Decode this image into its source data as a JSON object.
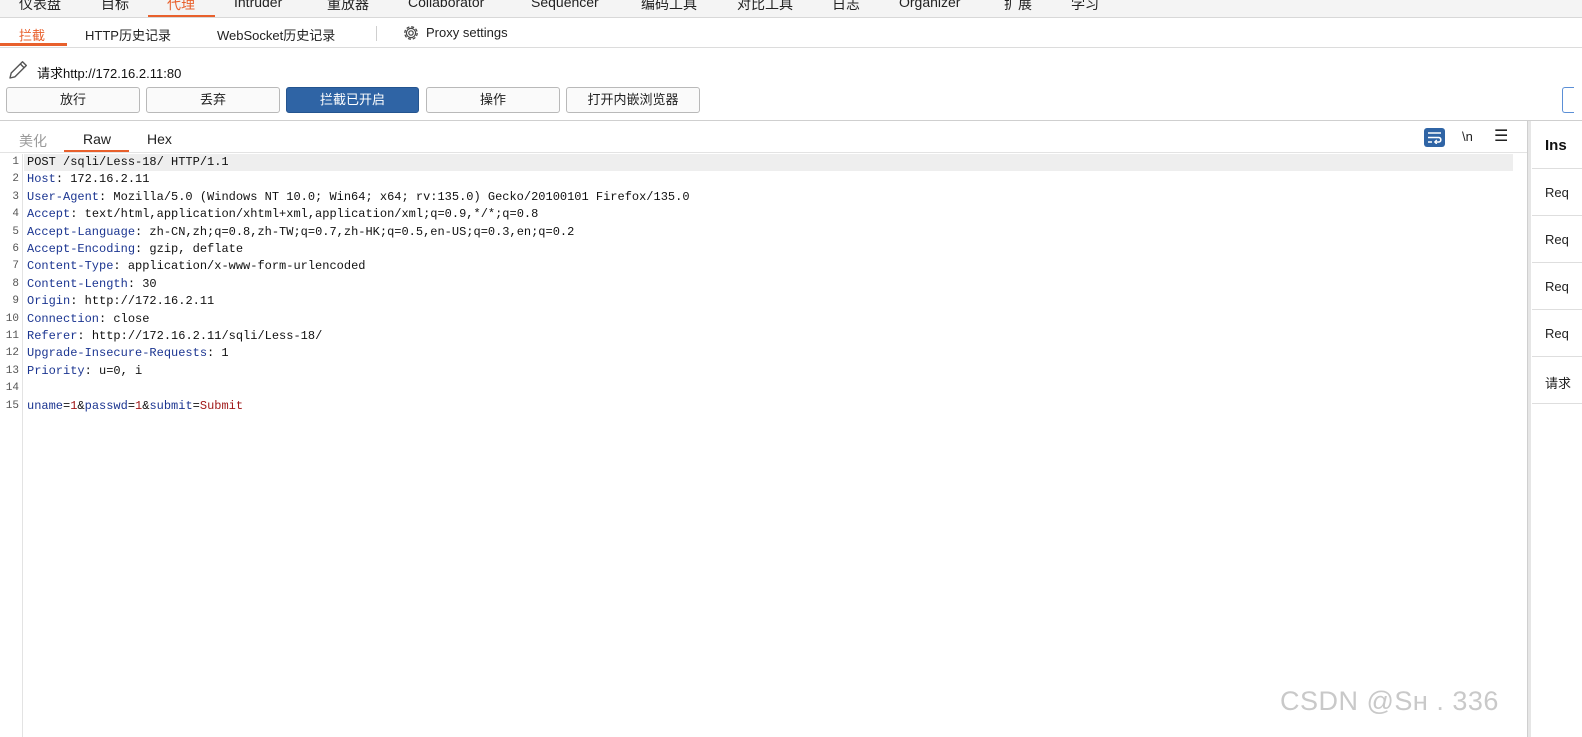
{
  "topnav": {
    "tabs": [
      "仪表盘",
      "目标",
      "代理",
      "Intruder",
      "重放器",
      "Collaborator",
      "Sequencer",
      "编码工具",
      "对比工具",
      "日志",
      "Organizer",
      "扩展",
      "学习"
    ],
    "active_tab": "代理"
  },
  "subnav": {
    "tabs": [
      "拦截",
      "HTTP历史记录",
      "WebSocket历史记录"
    ],
    "active_tab": "拦截",
    "proxy_settings": "Proxy settings"
  },
  "request": {
    "label": "请求http://172.16.2.11:80"
  },
  "buttons": {
    "forward": "放行",
    "drop": "丢弃",
    "intercept": "拦截已开启",
    "action": "操作",
    "open_browser": "打开内嵌浏览器"
  },
  "editor": {
    "tabs": [
      "美化",
      "Raw",
      "Hex"
    ],
    "active_tab": "Raw",
    "newline_toggle": "\\n",
    "menu_icon": "☰",
    "lines": [
      {
        "n": "1",
        "text": "POST /sqli/Less-18/ HTTP/1.1"
      },
      {
        "n": "2",
        "name": "Host",
        "value": " 172.16.2.11"
      },
      {
        "n": "3",
        "name": "User-Agent",
        "value": " Mozilla/5.0 (Windows NT 10.0; Win64; x64; rv:135.0) Gecko/20100101 Firefox/135.0"
      },
      {
        "n": "4",
        "name": "Accept",
        "value": " text/html,application/xhtml+xml,application/xml;q=0.9,*/*;q=0.8"
      },
      {
        "n": "5",
        "name": "Accept-Language",
        "value": " zh-CN,zh;q=0.8,zh-TW;q=0.7,zh-HK;q=0.5,en-US;q=0.3,en;q=0.2"
      },
      {
        "n": "6",
        "name": "Accept-Encoding",
        "value": " gzip, deflate"
      },
      {
        "n": "7",
        "name": "Content-Type",
        "value": " application/x-www-form-urlencoded"
      },
      {
        "n": "8",
        "name": "Content-Length",
        "value": " 30"
      },
      {
        "n": "9",
        "name": "Origin",
        "value": " http://172.16.2.11"
      },
      {
        "n": "10",
        "name": "Connection",
        "value": " close"
      },
      {
        "n": "11",
        "name": "Referer",
        "value": " http://172.16.2.11/sqli/Less-18/"
      },
      {
        "n": "12",
        "name": "Upgrade-Insecure-Requests",
        "value": " 1"
      },
      {
        "n": "13",
        "name": "Priority",
        "value": " u=0, i"
      },
      {
        "n": "14",
        "text": ""
      },
      {
        "n": "15",
        "body": [
          {
            "t": "pname",
            "s": "uname"
          },
          {
            "t": "punct",
            "s": "="
          },
          {
            "t": "pval",
            "s": "1"
          },
          {
            "t": "punct",
            "s": "&"
          },
          {
            "t": "pname",
            "s": "passwd"
          },
          {
            "t": "punct",
            "s": "="
          },
          {
            "t": "pval",
            "s": "1"
          },
          {
            "t": "punct",
            "s": "&"
          },
          {
            "t": "pname",
            "s": "submit"
          },
          {
            "t": "punct",
            "s": "="
          },
          {
            "t": "pval",
            "s": "Submit"
          }
        ]
      }
    ]
  },
  "inspector": {
    "title": "Ins",
    "rows": [
      "Req",
      "Req",
      "Req",
      "Req",
      "请求"
    ]
  },
  "watermark": "CSDN @Sʜ      .  336",
  "colors": {
    "accent": "#e8602c",
    "primary_button": "#2f64a5",
    "header_name": "#1b3591",
    "param_value": "#a11b1b"
  }
}
